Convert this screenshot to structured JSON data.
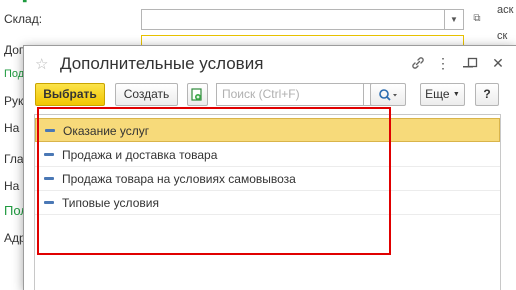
{
  "background_form": {
    "label_warehouse": "Склад:",
    "label_2": "Доп",
    "label_3": "Под",
    "label_4": "Рук",
    "label_5": "На с",
    "label_6": "Гла",
    "label_7": "На с",
    "label_8": "Пол",
    "label_9": "Адр",
    "right_text_1": "аск",
    "right_text_2": "ск"
  },
  "dialog": {
    "title": "Дополнительные условия",
    "toolbar": {
      "select_label": "Выбрать",
      "create_label": "Создать",
      "search_placeholder": "Поиск (Ctrl+F)",
      "clear_symbol": "×",
      "more_label": "Еще",
      "help_label": "?"
    },
    "items": [
      {
        "label": "Оказание услуг",
        "selected": true
      },
      {
        "label": "Продажа и доставка товара",
        "selected": false
      },
      {
        "label": "Продажа товара на условиях самовывоза",
        "selected": false
      },
      {
        "label": "Типовые условия",
        "selected": false
      }
    ]
  },
  "colors": {
    "accent_yellow": "#f2c500",
    "selection": "#f7da7a",
    "highlight_red": "#e00000",
    "green_link": "#1f9a3f"
  }
}
